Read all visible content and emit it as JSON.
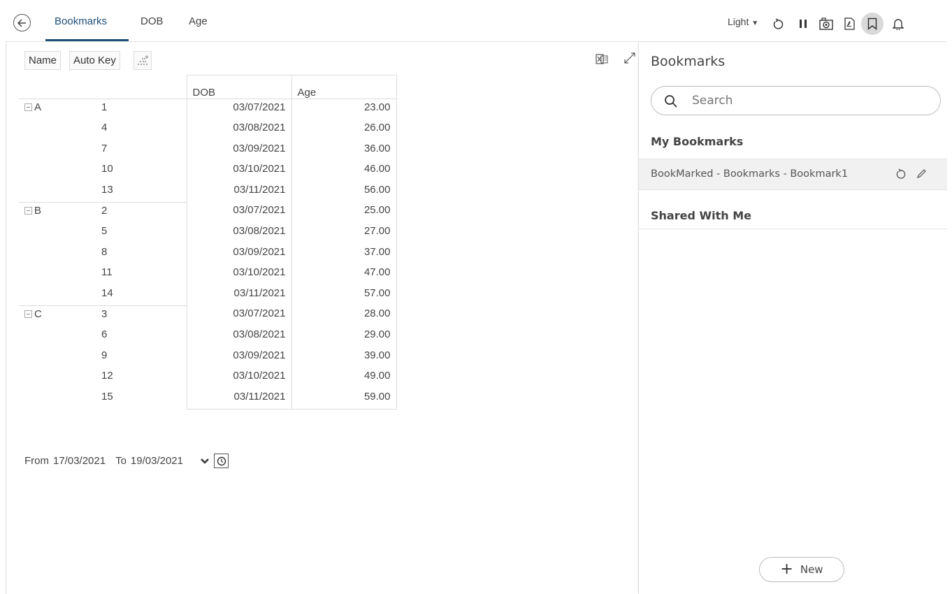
{
  "header": {
    "tabs": [
      {
        "label": "Bookmarks",
        "active": true
      },
      {
        "label": "DOB",
        "active": false
      },
      {
        "label": "Age",
        "active": false
      }
    ],
    "theme": "Light",
    "icons": [
      "back-arrow-icon",
      "refresh-icon",
      "pause-icon",
      "snapshot-icon",
      "pdf-icon",
      "bookmark-icon",
      "bell-icon"
    ],
    "accent_color": "#1f4e79"
  },
  "toolbar": {
    "chips": [
      "Name",
      "Auto Key"
    ]
  },
  "table": {
    "headers": {
      "dob": "DOB",
      "age": "Age"
    },
    "groups": [
      {
        "name": "A",
        "rows": [
          {
            "key": "1",
            "dob": "03/07/2021",
            "age": "23.00"
          },
          {
            "key": "4",
            "dob": "03/08/2021",
            "age": "26.00"
          },
          {
            "key": "7",
            "dob": "03/09/2021",
            "age": "36.00"
          },
          {
            "key": "10",
            "dob": "03/10/2021",
            "age": "46.00"
          },
          {
            "key": "13",
            "dob": "03/11/2021",
            "age": "56.00"
          }
        ]
      },
      {
        "name": "B",
        "rows": [
          {
            "key": "2",
            "dob": "03/07/2021",
            "age": "25.00"
          },
          {
            "key": "5",
            "dob": "03/08/2021",
            "age": "27.00"
          },
          {
            "key": "8",
            "dob": "03/09/2021",
            "age": "37.00"
          },
          {
            "key": "11",
            "dob": "03/10/2021",
            "age": "47.00"
          },
          {
            "key": "14",
            "dob": "03/11/2021",
            "age": "57.00"
          }
        ]
      },
      {
        "name": "C",
        "rows": [
          {
            "key": "3",
            "dob": "03/07/2021",
            "age": "28.00"
          },
          {
            "key": "6",
            "dob": "03/08/2021",
            "age": "29.00"
          },
          {
            "key": "9",
            "dob": "03/09/2021",
            "age": "39.00"
          },
          {
            "key": "12",
            "dob": "03/10/2021",
            "age": "49.00"
          },
          {
            "key": "15",
            "dob": "03/11/2021",
            "age": "59.00"
          }
        ]
      }
    ]
  },
  "filter": {
    "from_label": "From",
    "from_value": "17/03/2021",
    "to_label": "To",
    "to_value": "19/03/2021"
  },
  "panel": {
    "title": "Bookmarks",
    "search_placeholder": "Search",
    "my_bookmarks_heading": "My Bookmarks",
    "bookmarks": [
      "BookMarked - Bookmarks - Bookmark1"
    ],
    "shared_heading": "Shared With Me",
    "new_label": "New"
  }
}
